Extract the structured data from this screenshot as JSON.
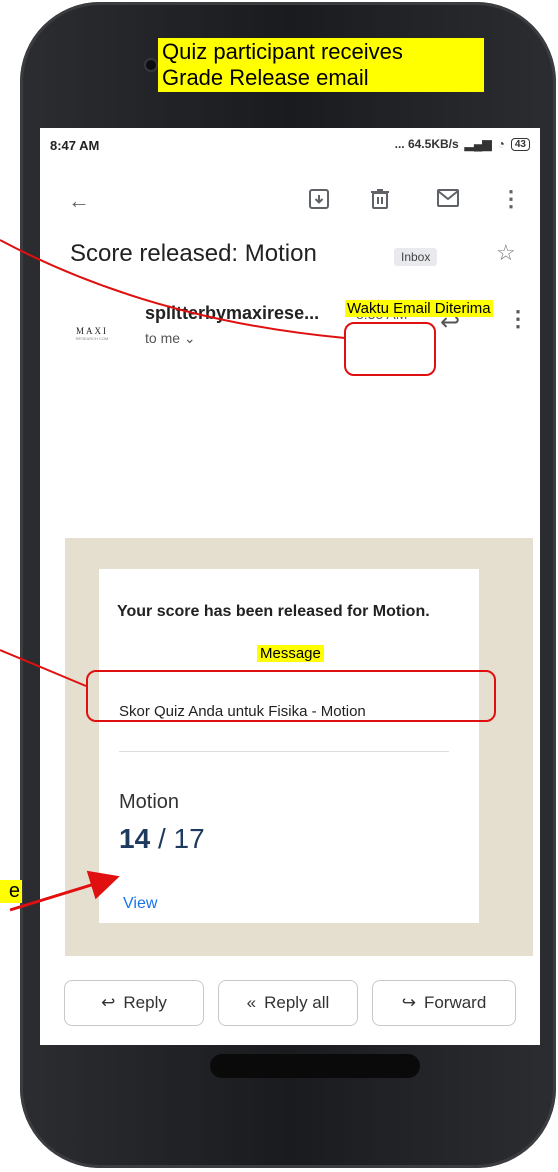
{
  "annotations": {
    "top_caption_line1": "Quiz participant receives",
    "top_caption_line2": "Grade Release email",
    "time_label": "Waktu Email Diterima",
    "message_label": "Message",
    "left_partial_label": "e"
  },
  "status_bar": {
    "time": "8:47 AM",
    "network": "... 64.5KB/s",
    "battery": "43"
  },
  "email": {
    "subject": "Score released: Motion",
    "inbox_label": "Inbox",
    "sender": "splitterbymaxirese...",
    "time": "8:35 AM",
    "to": "to me",
    "avatar_brand": "MAXI",
    "avatar_sub": "RESEARCH.COM",
    "body": {
      "heading": "Your score has been released for Motion.",
      "message": "Skor Quiz Anda untuk Fisika - Motion",
      "quiz_name": "Motion",
      "score_value": "14",
      "score_total": "/ 17",
      "view_link": "View"
    }
  },
  "actions": {
    "reply": "Reply",
    "reply_all": "Reply all",
    "forward": "Forward"
  },
  "icons": [
    "back-arrow-icon",
    "archive-icon",
    "trash-icon",
    "mail-icon",
    "more-vert-icon",
    "star-icon",
    "reply-icon",
    "reply-all-icon",
    "forward-icon",
    "chevron-down-icon"
  ],
  "colors": {
    "highlight": "#ffff00",
    "annotation_red": "#e01010",
    "email_bg": "#e5dfd0",
    "link": "#1a73e8"
  }
}
